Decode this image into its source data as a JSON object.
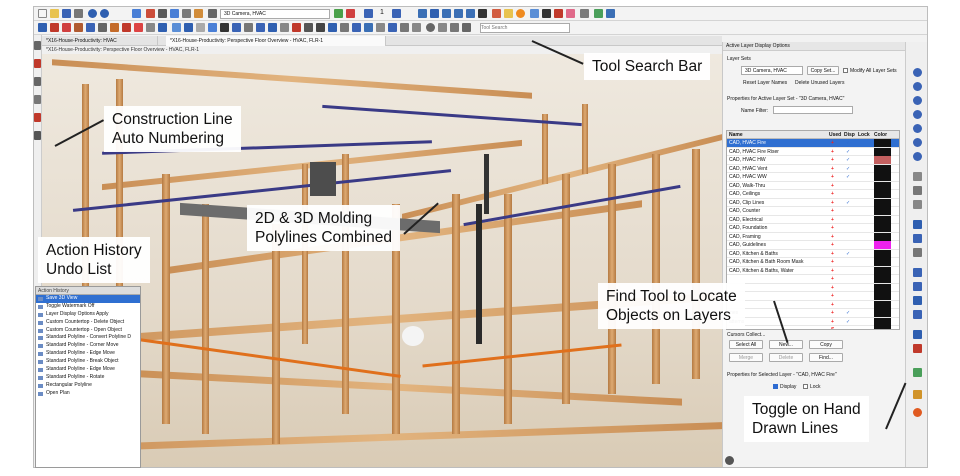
{
  "toolbar": {
    "camera_select": "3D Camera, HVAC",
    "search_placeholder": "Tool Search"
  },
  "tabs": [
    "*X16-House-Productivity: HVAC",
    "*X16-House-Productivity: Perspective Floor Overview - HVAC, FLR-1"
  ],
  "view_title": "*X16-House-Productivity: Perspective Floor Overview - HVAC, FLR-1",
  "panel": {
    "title": "Active Layer Display Options",
    "layer_sets_label": "Layer Sets",
    "layer_set_value": "3D Camera, HVAC",
    "copy_set": "Copy Set...",
    "modify_all": "Modify All Layer Sets",
    "reset_names": "Reset Layer Names",
    "delete_unused": "Delete Unused Layers",
    "props_active": "Properties for Active Layer Set - \"3D Camera, HVAC\"",
    "name_filter": "Name Filter:",
    "columns": {
      "name": "Name",
      "used": "Used",
      "disp": "Disp",
      "lock": "Lock",
      "color": "Color"
    },
    "layers": [
      {
        "name": "CAD,  HVAC Fire",
        "used": "+",
        "disp": "✓",
        "color": "#111111"
      },
      {
        "name": "CAD,  HVAC Fire Riser",
        "used": "+",
        "disp": "✓",
        "color": "#111111"
      },
      {
        "name": "CAD,  HVAC HW",
        "used": "+",
        "disp": "✓",
        "color": "#c46060"
      },
      {
        "name": "CAD,  HVAC Vent",
        "used": "+",
        "disp": "✓",
        "color": "#111111"
      },
      {
        "name": "CAD,  HVAC WW",
        "used": "+",
        "disp": "✓",
        "color": "#111111"
      },
      {
        "name": "CAD,  Walk-Thru",
        "used": "+",
        "disp": "",
        "color": "#111111"
      },
      {
        "name": "CAD,  Ceilings",
        "used": "+",
        "disp": "",
        "color": "#111111"
      },
      {
        "name": "CAD,  Clip Lines",
        "used": "+",
        "disp": "✓",
        "color": "#111111"
      },
      {
        "name": "CAD,  Counter",
        "used": "+",
        "disp": "",
        "color": "#111111"
      },
      {
        "name": "CAD,  Electrical",
        "used": "+",
        "disp": "",
        "color": "#111111"
      },
      {
        "name": "CAD,  Foundation",
        "used": "+",
        "disp": "",
        "color": "#111111"
      },
      {
        "name": "CAD,  Framing",
        "used": "+",
        "disp": "",
        "color": "#111111"
      },
      {
        "name": "CAD,  Guidelines",
        "used": "+",
        "disp": "",
        "color": "#ee22ee"
      },
      {
        "name": "CAD,  Kitchen & Baths",
        "used": "+",
        "disp": "✓",
        "color": "#111111"
      },
      {
        "name": "CAD,  Kitchen & Bath Room Mask",
        "used": "+",
        "disp": "",
        "color": "#111111"
      },
      {
        "name": "CAD,  Kitchen & Baths, Water",
        "used": "+",
        "disp": "",
        "color": "#111111"
      },
      {
        "name": "",
        "used": "+",
        "disp": "",
        "color": "#111111"
      },
      {
        "name": "",
        "used": "+",
        "disp": "",
        "color": "#111111"
      },
      {
        "name": "",
        "used": "+",
        "disp": "",
        "color": "#111111"
      },
      {
        "name": "",
        "used": "+",
        "disp": "",
        "color": "#111111"
      },
      {
        "name": "ines",
        "used": "+",
        "disp": "✓",
        "color": "#111111"
      },
      {
        "name": "atterns",
        "used": "+",
        "disp": "✓",
        "color": "#111111"
      },
      {
        "name": "",
        "used": "S",
        "disp": "",
        "color": "#111111"
      }
    ],
    "collapsed_row": "Cursors Collect...",
    "select_all": "Select All",
    "new": "New...",
    "copy": "Copy",
    "merge": "Merge",
    "delete": "Delete",
    "find": "Find...",
    "props_selected": "Properties for Selected Layer - \"CAD,  HVAC Fire\"",
    "display": "Display",
    "lock": "Lock"
  },
  "history": {
    "title": "Action History",
    "items": [
      "Save 3D View",
      "Toggle Watermark Off",
      "Layer Display Options Apply",
      "Custom Countertop - Delete Object",
      "Custom Countertop - Open Object",
      "Standard Polyline - Convert Polyline D",
      "Standard Polyline - Corner Move",
      "Standard Polyline - Edge Move",
      "Standard Polyline - Break Object",
      "Standard Polyline - Edge Move",
      "Standard Polyline - Rotate",
      "Rectangular Polyline",
      "Open Plan"
    ]
  },
  "callouts": {
    "tool_search": "Tool Search Bar",
    "construction_line": "Construction Line\nAuto Numbering",
    "molding": "2D & 3D Molding\nPolylines Combined",
    "action_history": "Action History\nUndo List",
    "find_tool": "Find Tool to Locate\nObjects on Layers",
    "hand_drawn": "Toggle on Hand\nDrawn Lines"
  },
  "toolbar_number": "1"
}
